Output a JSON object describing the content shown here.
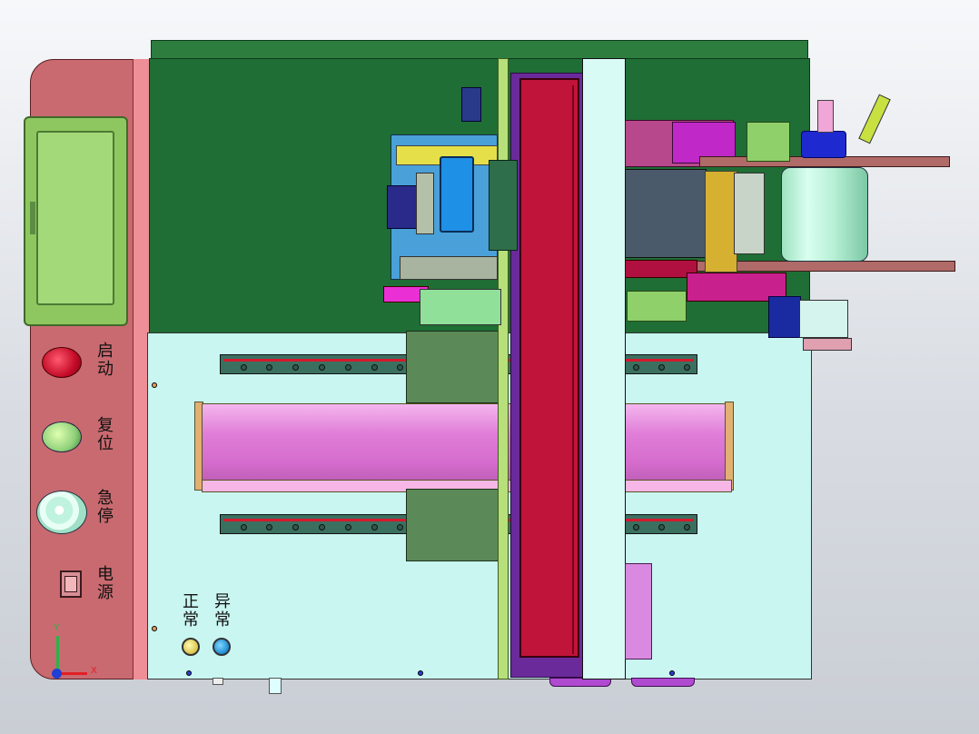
{
  "control_panel": {
    "start_label": "启动",
    "reset_label": "复位",
    "estop_label": "急停",
    "power_label": "电源"
  },
  "status_lights": {
    "normal_label": "正常",
    "abnormal_label": "异常"
  },
  "axis_triad": {
    "x_label": "X",
    "y_label": "Y"
  },
  "colors": {
    "panel": "#c86068",
    "frame_green": "#1f6e35",
    "base": "#c8f4ef",
    "red_panel": "#c0143a",
    "magenta_roller": "#e080d8"
  }
}
